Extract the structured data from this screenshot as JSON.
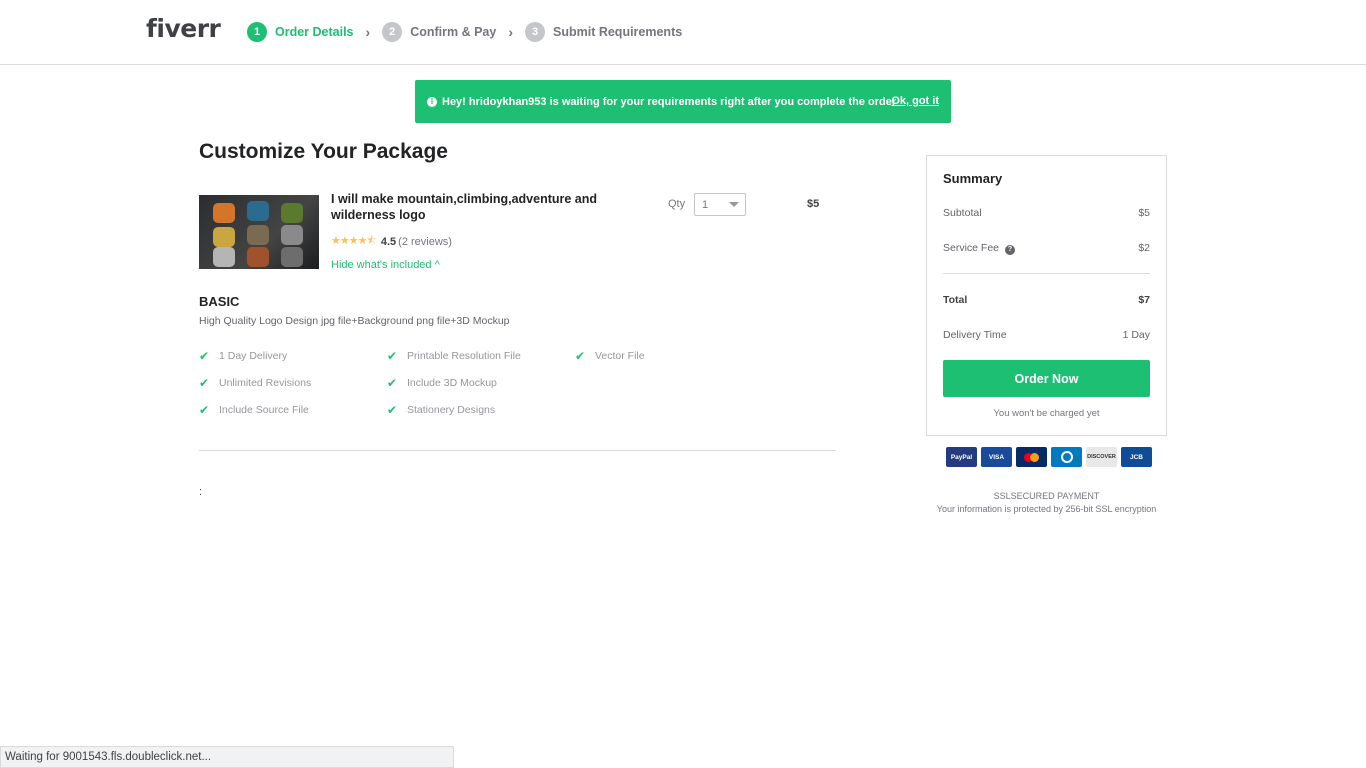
{
  "header": {
    "logo": "fiverr",
    "steps": [
      {
        "num": "1",
        "label": "Order Details"
      },
      {
        "num": "2",
        "label": "Confirm & Pay"
      },
      {
        "num": "3",
        "label": "Submit Requirements"
      }
    ]
  },
  "banner": {
    "info_icon": "i",
    "text": "Hey! hridoykhan953 is waiting for your requirements right after you complete the order",
    "link": "Ok, got it"
  },
  "page_title": "Customize Your Package",
  "gig": {
    "title": "I will make mountain,climbing,adventure and wilderness logo",
    "stars": "★★★★⯪",
    "rating": "4.5",
    "reviews": "(2 reviews)",
    "hide_included": "Hide what's included ^",
    "qty_label": "Qty",
    "qty_value": "1",
    "price": "$5"
  },
  "package": {
    "name": "BASIC",
    "description": "High Quality Logo Design jpg file+Background png file+3D Mockup",
    "features": [
      "1 Day Delivery",
      "Printable Resolution File",
      "Vector File",
      "Unlimited Revisions",
      "Include 3D Mockup",
      "Include Source File",
      "Stationery Designs"
    ],
    "check_glyph": "✔"
  },
  "extra_colon": ":",
  "summary": {
    "title": "Summary",
    "subtotal_label": "Subtotal",
    "subtotal_value": "$5",
    "fee_label": "Service Fee",
    "fee_icon": "?",
    "fee_value": "$2",
    "total_label": "Total",
    "total_value": "$7",
    "delivery_label": "Delivery Time",
    "delivery_value": "1 Day",
    "order_button": "Order Now",
    "no_charge": "You won't be charged yet"
  },
  "payment_cards": [
    {
      "name": "PayPal",
      "color": "#253b80"
    },
    {
      "name": "VISA",
      "color": "#1a4b9b"
    },
    {
      "name": "MC",
      "color": "#0a2a66"
    },
    {
      "name": "Diners",
      "color": "#0079be"
    },
    {
      "name": "DISCOVER",
      "color": "#e8e8e8"
    },
    {
      "name": "JCB",
      "color": "#0e4c96"
    }
  ],
  "ssl": {
    "line1": "SSLSECURED PAYMENT",
    "line2": "Your information is protected by 256-bit SSL encryption"
  },
  "status_bar": "Waiting for 9001543.fls.doubleclick.net..."
}
